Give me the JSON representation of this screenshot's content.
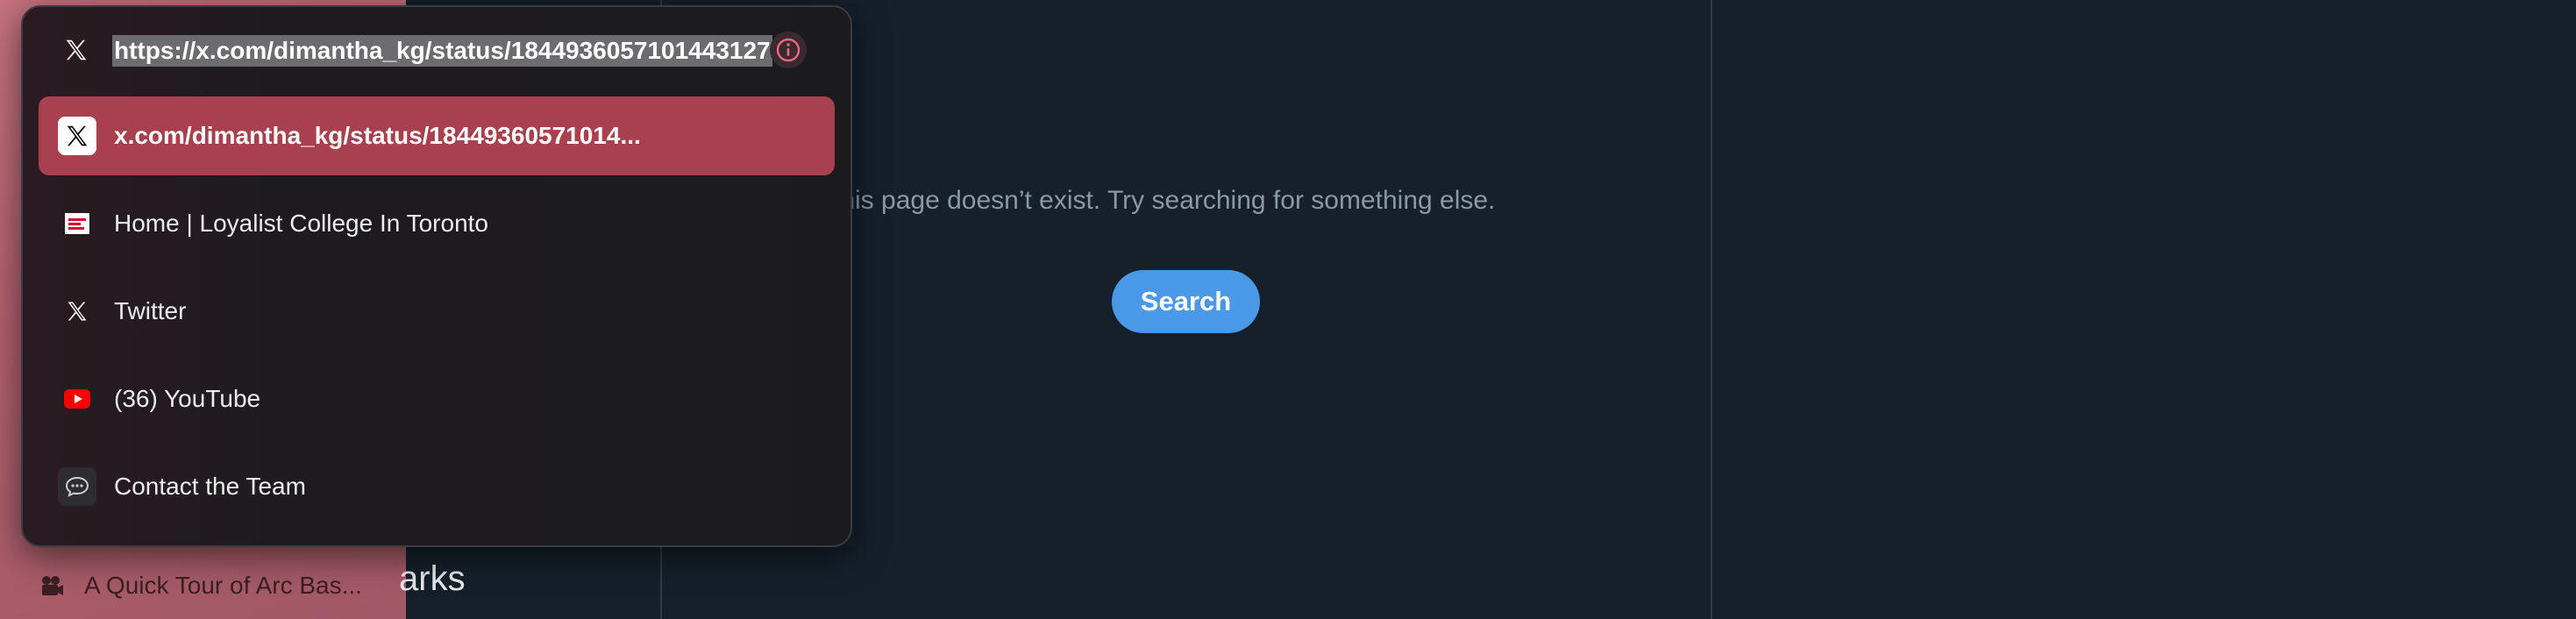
{
  "background_page": {
    "not_found_text": "m...this page doesn’t exist. Try searching for something else.",
    "search_button_label": "Search",
    "bookmarks_label_fragment": "arks",
    "sidebar_tab_label": "A Quick Tour of Arc Bas..."
  },
  "command_bar": {
    "url": "https://x.com/dimantha_kg/status/1844936057101443127",
    "url_favicon": "x-logo-icon",
    "info_icon": "info-icon",
    "suggestions": [
      {
        "label": "x.com/dimantha_kg/status/18449360571014...",
        "icon": "x-logo-icon",
        "selected": true
      },
      {
        "label": "Home | Loyalist College In Toronto",
        "icon": "loyalist-favicon-icon",
        "selected": false
      },
      {
        "label": "Twitter",
        "icon": "x-logo-icon",
        "selected": false
      },
      {
        "label": "(36) YouTube",
        "icon": "youtube-icon",
        "selected": false
      },
      {
        "label": "Contact the Team",
        "icon": "chat-bubble-icon",
        "selected": false
      }
    ]
  },
  "colors": {
    "selected_row": "#a8404f",
    "search_button": "#4a99e9",
    "page_background": "#15202b"
  }
}
